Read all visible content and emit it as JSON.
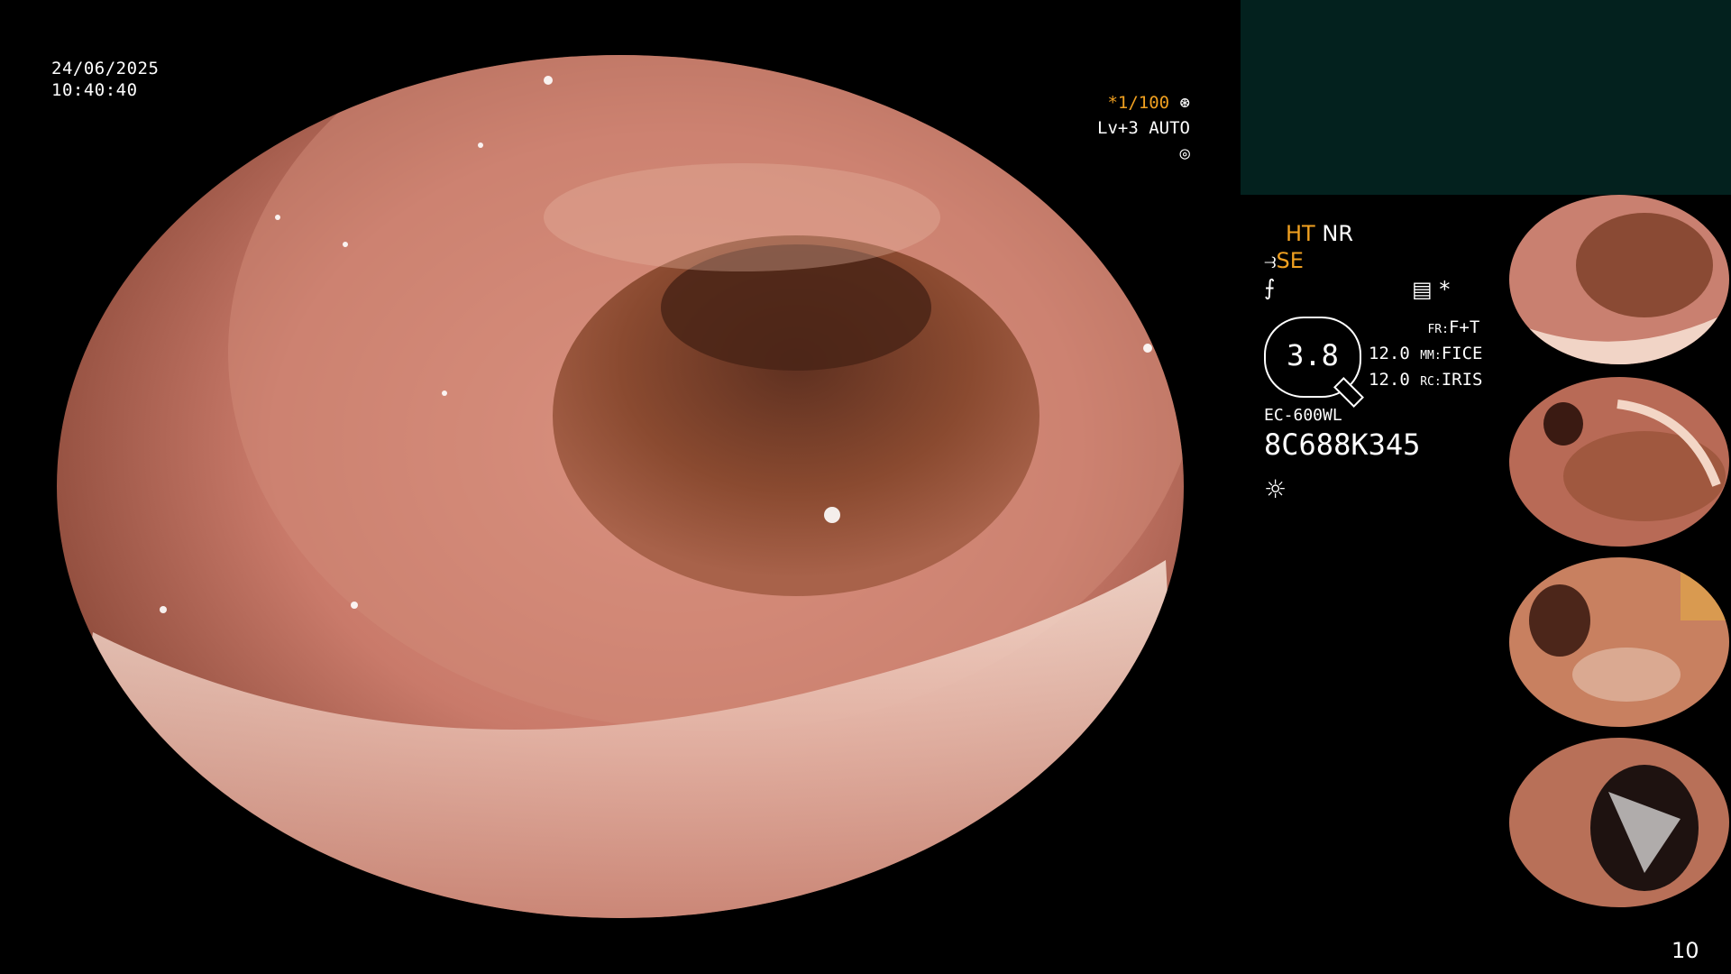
{
  "datetime": {
    "date": "24/06/2025",
    "time": "10:40:40"
  },
  "shutter": {
    "speed": "*1/100",
    "level": "Lv+3 AUTO"
  },
  "settings": {
    "ht": "HT",
    "nr": "NR",
    "se": "SE",
    "zoom": "3.8",
    "fr_label": "FR:",
    "fr_value": "F+T",
    "mm_label": "MM:",
    "mm_value": "FICE",
    "rc_label": "RC:",
    "rc_value": "IRIS",
    "val1": "12.0",
    "val2": "12.0",
    "asterisk": "*",
    "scope_model": "EC-600WL",
    "serial": "8C688K345"
  },
  "icons": {
    "shutter_icon": "aperture-icon",
    "auto_icon": "target-icon",
    "scope_icon": "scope-icon",
    "filter_icon": "filter-icon",
    "record_icon": "record-icon",
    "light_icon": "light-icon"
  },
  "colors": {
    "accent": "#f0a020",
    "panel": "#03211e",
    "tissue": "#c97a6a"
  },
  "thumbnails": [
    {
      "id": "thumb-1"
    },
    {
      "id": "thumb-2"
    },
    {
      "id": "thumb-3"
    },
    {
      "id": "thumb-4"
    }
  ],
  "page_number": "10"
}
